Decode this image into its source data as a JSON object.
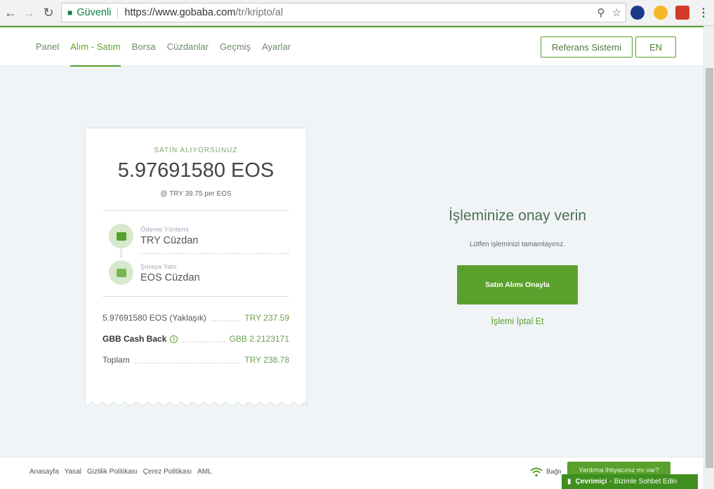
{
  "browser": {
    "secure_label": "Güvenli",
    "url_host": "https://www.gobaba.com",
    "url_path": "/tr/kripto/al"
  },
  "nav": {
    "items": [
      {
        "label": "Panel"
      },
      {
        "label": "Alım - Satım"
      },
      {
        "label": "Borsa"
      },
      {
        "label": "Cüzdanlar"
      },
      {
        "label": "Geçmiş"
      },
      {
        "label": "Ayarlar"
      }
    ],
    "active_index": 1,
    "referral_label": "Referans Sistemi",
    "lang_label": "EN"
  },
  "receipt": {
    "header_label": "SATIN ALIYORSUNUZ",
    "amount": "5.97691580 EOS",
    "rate": "@ TRY 39.75 per EOS",
    "payment_method_label": "Ödeme Yöntemi",
    "payment_method": "TRY Cüzdan",
    "deposit_label": "Şuraya Yatır",
    "deposit_wallet": "EOS Cüzdan",
    "rows": [
      {
        "key": "5.97691580 EOS (Yaklaşık)",
        "value": "TRY 237.59"
      },
      {
        "key": "GBB Cash Back",
        "value": "GBB 2.2123171"
      },
      {
        "key": "Toplam",
        "value": "TRY 238.78"
      }
    ]
  },
  "confirm": {
    "title": "İşleminize onay verin",
    "subtitle": "Lütfen işleminizi tamamlayınız.",
    "confirm_button": "Satın Alımı Onayla",
    "cancel_link": "İşlemi İptal Et"
  },
  "footer": {
    "links": [
      "Anasayfa",
      "Yasal",
      "Gizlilik Politikası",
      "Çerez Politikası",
      "AML"
    ],
    "status": "Bağlı",
    "help_button": "Yardıma ihtiyacınız mı var?",
    "chat_online": "Çevrimiçi",
    "chat_text": "- Bizimle Sohbet Edin"
  },
  "colors": {
    "accent": "#5aa02c",
    "background": "#f1f4f6"
  }
}
